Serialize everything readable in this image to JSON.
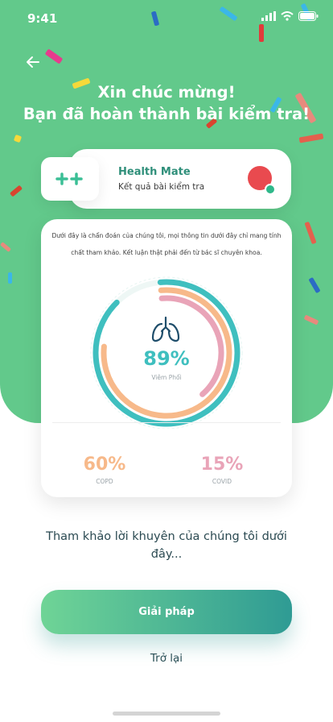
{
  "status_bar": {
    "time": "9:41"
  },
  "header": {
    "title_line1": "Xin chúc mừng!",
    "title_line2": "Bạn đã hoàn thành bài kiểm tra!"
  },
  "app_card": {
    "name": "Health Mate",
    "subtitle": "Kết quả bài kiểm tra"
  },
  "result": {
    "disclaimer": "Dưới đây là chẩn đoán của chúng tôi, mọi thông tin dưới đây chỉ mang tính chất tham khảo. Kết luận thật phải đến từ bác sĩ chuyên khoa.",
    "primary": {
      "percent_text": "89%",
      "label": "Viêm Phổi",
      "value": 89
    },
    "secondary": [
      {
        "percent_text": "60%",
        "label": "COPD",
        "value": 60,
        "color": "#f7b98a"
      },
      {
        "percent_text": "15%",
        "label": "COVID",
        "value": 15,
        "color": "#e9a4b8"
      }
    ],
    "colors": {
      "primary": "#3fbfbf",
      "secondary_a": "#f7b98a",
      "secondary_b": "#e9a4b8"
    }
  },
  "advice_text": "Tham khảo lời khuyên của chúng tôi dưới đây...",
  "actions": {
    "solution_label": "Giải pháp",
    "back_label": "Trở lại"
  },
  "theme": {
    "hero_bg": "#62c98b",
    "accent": "#3fbfbf"
  }
}
